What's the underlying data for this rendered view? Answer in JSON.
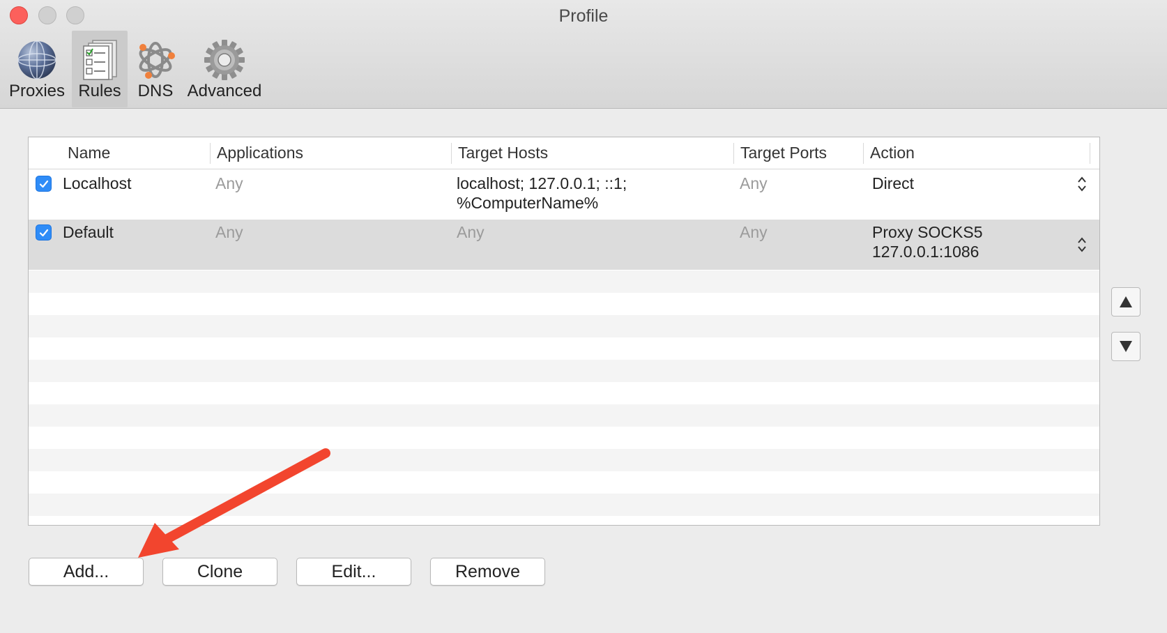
{
  "window": {
    "title": "Profile"
  },
  "toolbar": {
    "items": [
      {
        "label": "Proxies",
        "icon": "globe-icon"
      },
      {
        "label": "Rules",
        "icon": "rules-checklist-icon",
        "selected": true
      },
      {
        "label": "DNS",
        "icon": "dns-network-icon"
      },
      {
        "label": "Advanced",
        "icon": "gear-icon"
      }
    ]
  },
  "table": {
    "columns": [
      "Name",
      "Applications",
      "Target Hosts",
      "Target Ports",
      "Action"
    ],
    "rows": [
      {
        "enabled": true,
        "name": "Localhost",
        "applications": "Any",
        "target_hosts": "localhost; 127.0.0.1; ::1;\n%ComputerName%",
        "target_ports": "Any",
        "action": "Direct"
      },
      {
        "enabled": true,
        "name": "Default",
        "applications": "Any",
        "target_hosts": "Any",
        "target_ports": "Any",
        "action": "Proxy SOCKS5\n127.0.0.1:1086"
      }
    ]
  },
  "buttons": {
    "add": "Add...",
    "clone": "Clone",
    "edit": "Edit...",
    "remove": "Remove"
  },
  "colors": {
    "checkbox": "#2f8cf7",
    "selected_row": "#dcdcdc",
    "annotation_arrow": "#f2452e",
    "close_button": "#fc605c"
  }
}
